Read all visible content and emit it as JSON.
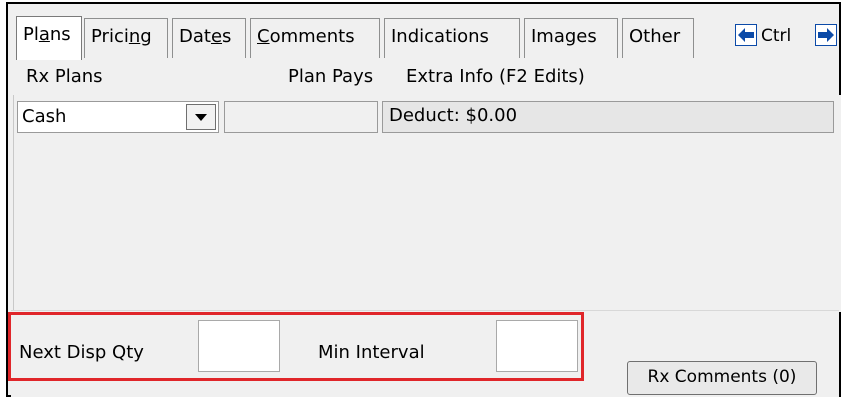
{
  "tabs": [
    {
      "pre": "Pl",
      "ul": "a",
      "post": "ns"
    },
    {
      "pre": "Prici",
      "ul": "n",
      "post": "g"
    },
    {
      "pre": "Dat",
      "ul": "e",
      "post": "s"
    },
    {
      "pre": "",
      "ul": "C",
      "post": "omments"
    },
    {
      "pre": "Indications",
      "ul": "",
      "post": ""
    },
    {
      "pre": "Images",
      "ul": "",
      "post": ""
    },
    {
      "pre": "Other",
      "ul": "",
      "post": ""
    }
  ],
  "nav": {
    "ctrl_label": "Ctrl"
  },
  "columns": {
    "rx_plans": "Rx Plans",
    "plan_pays": "Plan Pays",
    "extra_info": "Extra Info (F2 Edits)"
  },
  "row": {
    "plan": "Cash",
    "plan_pays": "",
    "extra_info": "Deduct: $0.00"
  },
  "bottom": {
    "next_disp_qty_label": "Next Disp Qty",
    "next_disp_qty_value": "",
    "min_interval_label": "Min Interval",
    "min_interval_value": "",
    "rx_comments_label": "Rx Comments (0)"
  },
  "colors": {
    "highlight": "#e0262a",
    "arrow": "#0b4aa8"
  },
  "icons": {
    "prev": "left-arrow-icon",
    "next": "right-arrow-icon",
    "dropdown": "chevron-down-icon"
  }
}
